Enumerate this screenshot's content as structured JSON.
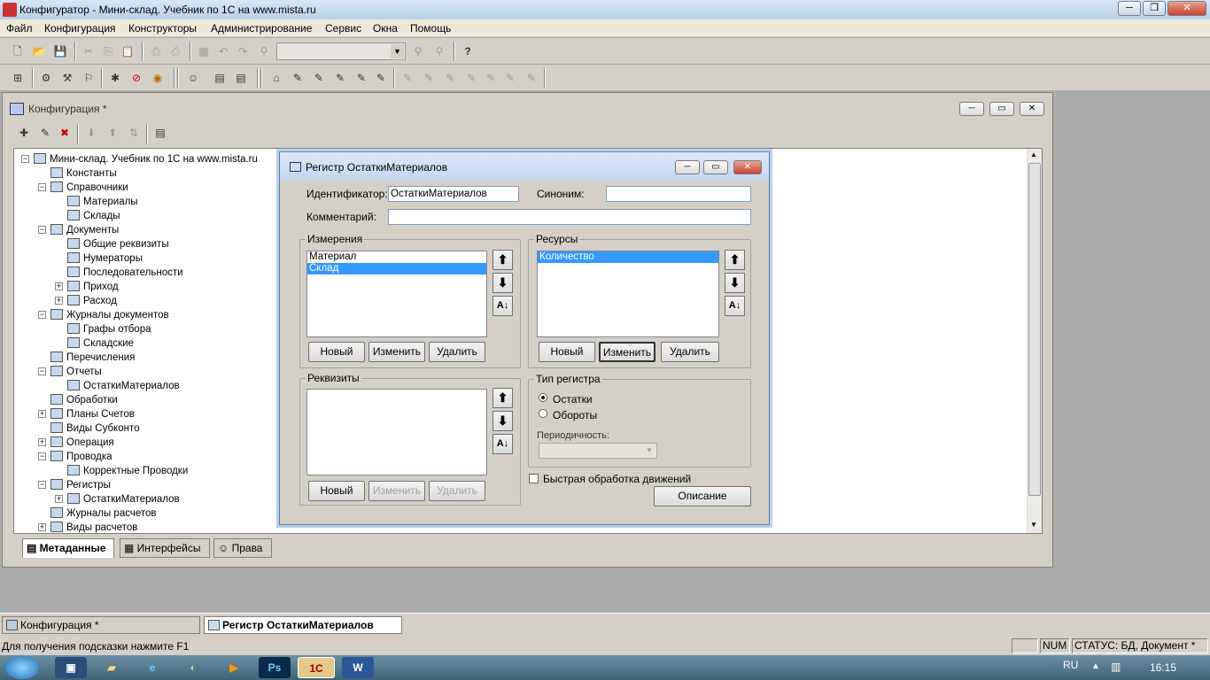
{
  "app": {
    "title": "Конфигуратор - Мини-склад. Учебник по 1С на www.mista.ru"
  },
  "menu": [
    "Файл",
    "Конфигурация",
    "Конструкторы",
    "Администрирование",
    "Сервис",
    "Окна",
    "Помощь"
  ],
  "cfg_window": {
    "title": "Конфигурация *"
  },
  "tree": [
    {
      "label": "Мини-склад. Учебник по 1С на www.mista.ru",
      "icon": "config-icon"
    },
    {
      "label": "Константы",
      "icon": "constants-icon"
    },
    {
      "label": "Справочники",
      "icon": "catalogs-icon"
    },
    {
      "label": "Материалы",
      "icon": "catalog-icon"
    },
    {
      "label": "Склады",
      "icon": "catalog-icon"
    },
    {
      "label": "Документы",
      "icon": "documents-icon"
    },
    {
      "label": "Общие реквизиты",
      "icon": "attributes-icon"
    },
    {
      "label": "Нумераторы",
      "icon": "numerator-icon"
    },
    {
      "label": "Последовательности",
      "icon": "sequence-icon"
    },
    {
      "label": "Приход",
      "icon": "document-icon"
    },
    {
      "label": "Расход",
      "icon": "document-icon"
    },
    {
      "label": "Журналы документов",
      "icon": "journals-icon"
    },
    {
      "label": "Графы отбора",
      "icon": "filter-icon"
    },
    {
      "label": "Складские",
      "icon": "journal-icon"
    },
    {
      "label": "Перечисления",
      "icon": "enum-icon"
    },
    {
      "label": "Отчеты",
      "icon": "reports-icon"
    },
    {
      "label": "ОстаткиМатериалов",
      "icon": "report-icon"
    },
    {
      "label": "Обработки",
      "icon": "processing-icon"
    },
    {
      "label": "Планы Счетов",
      "icon": "accounts-icon"
    },
    {
      "label": "Виды Субконто",
      "icon": "subconto-icon"
    },
    {
      "label": "Операция",
      "icon": "operation-icon"
    },
    {
      "label": "Проводка",
      "icon": "entry-icon"
    },
    {
      "label": "Корректные Проводки",
      "icon": "entry-icon"
    },
    {
      "label": "Регистры",
      "icon": "registers-icon"
    },
    {
      "label": "ОстаткиМатериалов",
      "icon": "register-icon"
    },
    {
      "label": "Журналы расчетов",
      "icon": "calc-journal-icon"
    },
    {
      "label": "Виды расчетов",
      "icon": "calc-kind-icon"
    }
  ],
  "tabs": [
    "Метаданные",
    "Интерфейсы",
    "Права"
  ],
  "dialog": {
    "title": "Регистр ОстаткиМатериалов",
    "id_label": "Идентификатор:",
    "id_value": "ОстаткиМатериалов",
    "syn_label": "Синоним:",
    "syn_value": "",
    "comment_label": "Комментарий:",
    "comment_value": "",
    "dims": {
      "title": "Измерения",
      "items": [
        "Материал",
        "Склад"
      ]
    },
    "res": {
      "title": "Ресурсы",
      "items": [
        "Количество"
      ]
    },
    "reqs": {
      "title": "Реквизиты",
      "items": []
    },
    "btn_new": "Новый",
    "btn_edit": "Изменить",
    "btn_del": "Удалить",
    "type": {
      "title": "Тип регистра",
      "opt1": "Остатки",
      "opt2": "Обороты",
      "period_label": "Периодичность:"
    },
    "fast": "Быстрая обработка движений",
    "desc_btn": "Описание"
  },
  "taskbar": {
    "item1": "Конфигурация *",
    "item2": "Регистр ОстаткиМатериалов"
  },
  "status": {
    "hint": "Для получения подсказки нажмите F1",
    "num": "NUM",
    "state": "СТАТУС: БД, Документ *"
  },
  "win": {
    "lang": "RU",
    "time": "16:15"
  }
}
